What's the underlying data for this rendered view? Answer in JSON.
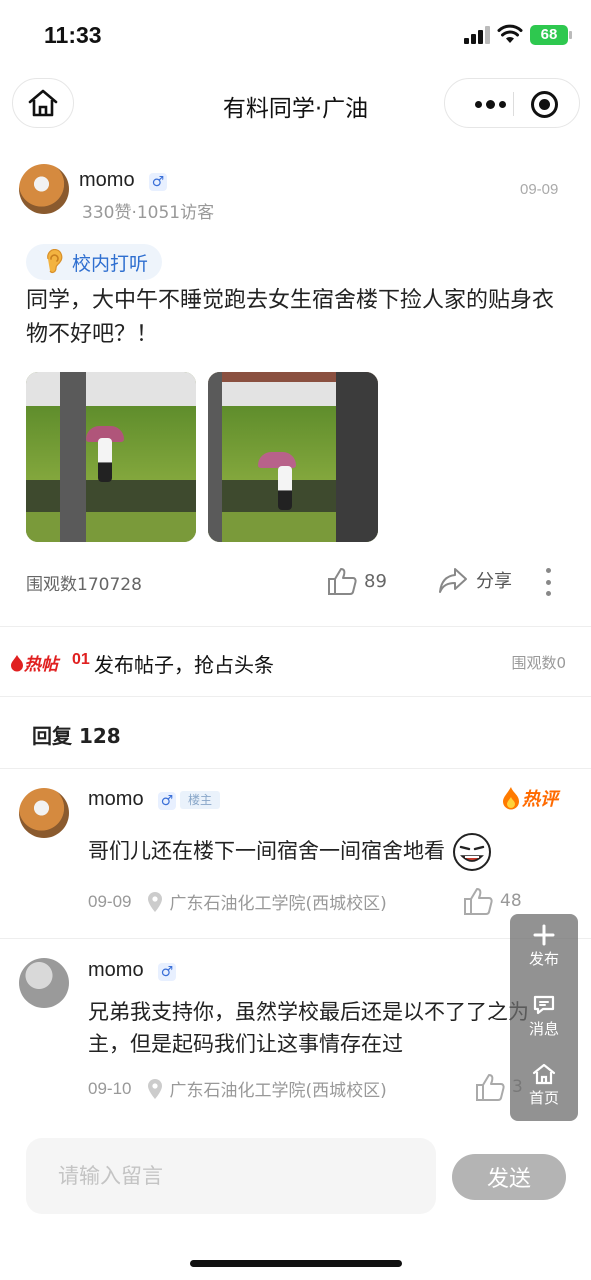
{
  "status_bar": {
    "time": "11:33",
    "battery": "68"
  },
  "nav": {
    "title": "有料同学·广油"
  },
  "post": {
    "author": "momo",
    "gender_symbol": "♂",
    "stats": "330赞·1051访客",
    "date": "09-09",
    "tag": {
      "icon": "ear-icon",
      "label": "校内打听"
    },
    "text": "同学，大中午不睡觉跑去女生宿舍楼下捡人家的贴身衣物不好吧？！",
    "views": "围观数170728",
    "likes": "89",
    "share_label": "分享"
  },
  "hot_bar": {
    "badge": "热帖",
    "rank": "01",
    "text": "发布帖子，抢占头条",
    "views": "围观数0"
  },
  "replies": {
    "header": "回复 128",
    "comments": [
      {
        "author": "momo",
        "gender_symbol": "♂",
        "owner_badge": "楼主",
        "hot_badge": "热评",
        "text": "哥们儿还在楼下一间宿舍一间宿舍地看",
        "date": "09-09",
        "location": "广东石油化工学院(西城校区)",
        "likes": "48"
      },
      {
        "author": "momo",
        "gender_symbol": "♂",
        "text": "兄弟我支持你，虽然学校最后还是以不了了之为主，但是起码我们让这事情存在过",
        "date": "09-10",
        "location": "广东石油化工学院(西城校区)",
        "likes": "3"
      }
    ]
  },
  "float_menu": {
    "publish": "发布",
    "messages": "消息",
    "home": "首页"
  },
  "input_bar": {
    "placeholder": "请输入留言",
    "send_label": "发送"
  },
  "colors": {
    "accent_blue": "#2f6fd0",
    "hot_red": "#e02020",
    "hot_orange": "#ff6a00",
    "battery_green": "#2ec84f"
  }
}
